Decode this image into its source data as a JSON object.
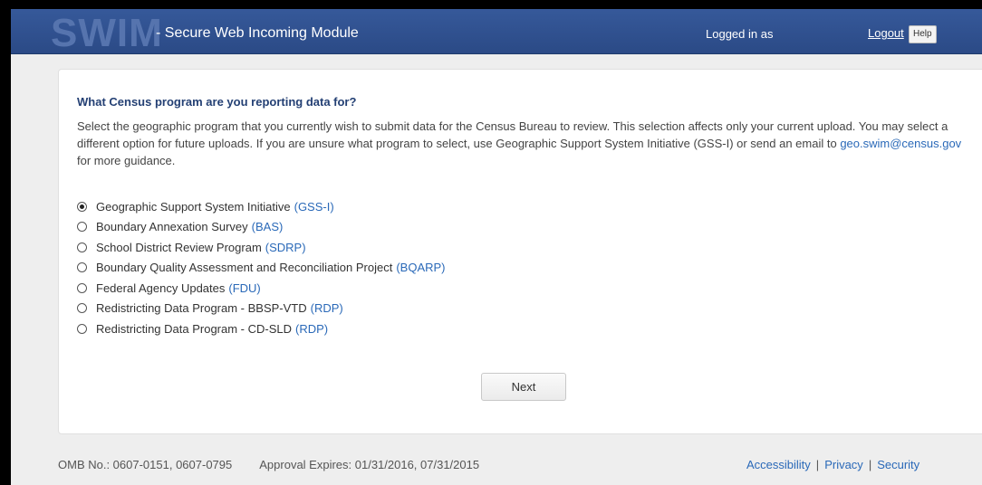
{
  "header": {
    "logo": "SWIM",
    "subtitle": "- Secure Web Incoming Module",
    "logged_in_text": "Logged in as",
    "logout_label": "Logout",
    "help_label": "Help"
  },
  "panel": {
    "question": "What Census program are you reporting data for?",
    "desc_part1": "Select the geographic program that you currently wish to submit data for the Census Bureau to review. This selection affects only your current upload. You may select a different option for future uploads. If you are unsure what program to select, use Geographic Support System Initiative (GSS-I) or send an email to ",
    "email": "geo.swim@census.gov",
    "desc_part2": " for more guidance.",
    "options": [
      {
        "label": "Geographic Support System Initiative",
        "abbr": "(GSS-I)",
        "checked": true
      },
      {
        "label": "Boundary Annexation Survey",
        "abbr": "(BAS)",
        "checked": false
      },
      {
        "label": "School District Review Program",
        "abbr": "(SDRP)",
        "checked": false
      },
      {
        "label": "Boundary Quality Assessment and Reconciliation Project",
        "abbr": "(BQARP)",
        "checked": false
      },
      {
        "label": "Federal Agency Updates",
        "abbr": "(FDU)",
        "checked": false
      },
      {
        "label": "Redistricting Data Program - BBSP-VTD",
        "abbr": "(RDP)",
        "checked": false
      },
      {
        "label": "Redistricting Data Program - CD-SLD",
        "abbr": "(RDP)",
        "checked": false
      }
    ],
    "next_label": "Next"
  },
  "footer": {
    "omb": "OMB No.: 0607-0151, 0607-0795",
    "approval": "Approval Expires: 01/31/2016, 07/31/2015",
    "links": [
      "Accessibility",
      "Privacy",
      "Security"
    ],
    "separator": "|"
  }
}
